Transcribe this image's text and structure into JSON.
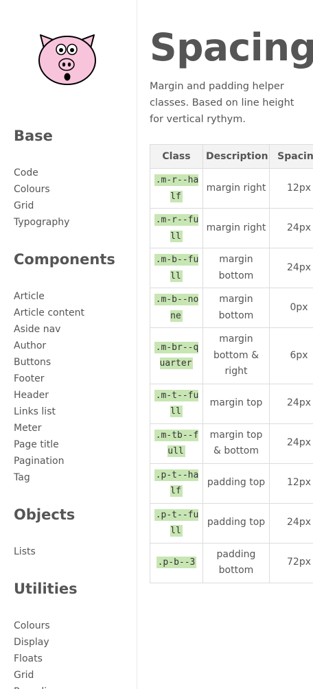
{
  "sidebar": {
    "sections": [
      {
        "title": "Base",
        "items": [
          "Code",
          "Colours",
          "Grid",
          "Typography"
        ]
      },
      {
        "title": "Components",
        "items": [
          "Article",
          "Article content",
          "Aside nav",
          "Author",
          "Buttons",
          "Footer",
          "Header",
          "Links list",
          "Meter",
          "Page title",
          "Pagination",
          "Tag"
        ]
      },
      {
        "title": "Objects",
        "items": [
          "Lists"
        ]
      },
      {
        "title": "Utilities",
        "items": [
          "Colours",
          "Display",
          "Floats",
          "Grid",
          "Rounding"
        ]
      }
    ]
  },
  "main": {
    "title": "Spacing",
    "intro": "Margin and padding helper classes. Based on line height for vertical rythym.",
    "table": {
      "headers": [
        "Class",
        "Description",
        "Spacing"
      ],
      "rows": [
        {
          "cls": ".m-r--half",
          "desc": "margin right",
          "spacing": "12px"
        },
        {
          "cls": ".m-r--full",
          "desc": "margin right",
          "spacing": "24px"
        },
        {
          "cls": ".m-b--full",
          "desc": "margin bottom",
          "spacing": "24px"
        },
        {
          "cls": ".m-b--none",
          "desc": "margin bottom",
          "spacing": "0px"
        },
        {
          "cls": ".m-br--quarter",
          "desc": "margin bottom & right",
          "spacing": "6px"
        },
        {
          "cls": ".m-t--full",
          "desc": "margin top",
          "spacing": "24px"
        },
        {
          "cls": ".m-tb--full",
          "desc": "margin top & bottom",
          "spacing": "24px"
        },
        {
          "cls": ".p-t--half",
          "desc": "padding top",
          "spacing": "12px"
        },
        {
          "cls": ".p-t--full",
          "desc": "padding top",
          "spacing": "24px"
        },
        {
          "cls": ".p-b--3",
          "desc": "padding bottom",
          "spacing": "72px"
        }
      ]
    }
  },
  "colors": {
    "pig_pink": "#f8c4dc",
    "code_background": "#c8e6b4",
    "header_background": "#f3f3f3",
    "text": "#555555"
  }
}
